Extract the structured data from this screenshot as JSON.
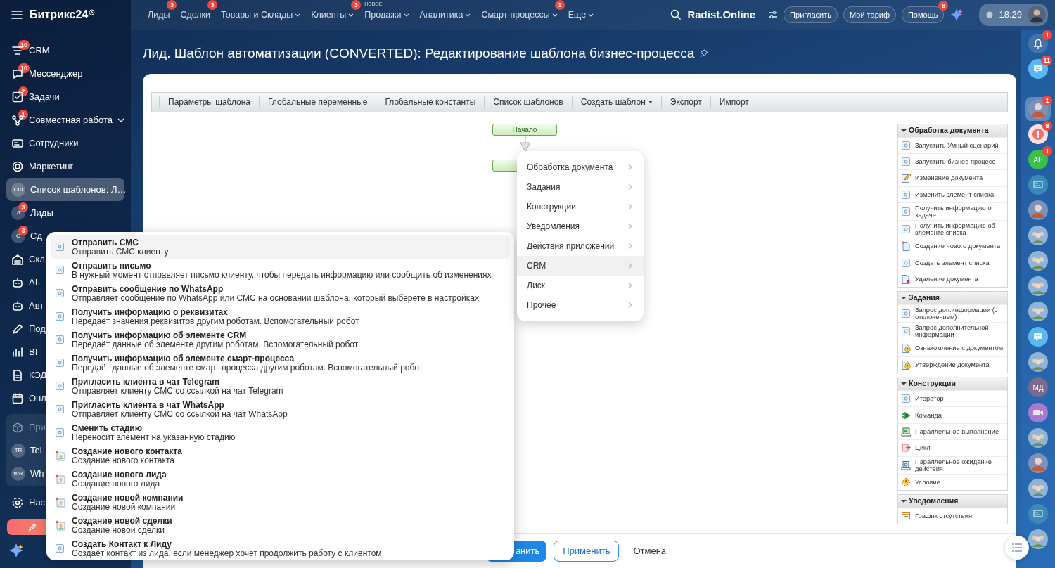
{
  "app": {
    "logo": "Битрикс24"
  },
  "top_nav": [
    {
      "label": "Лиды",
      "badge": "3"
    },
    {
      "label": "Сделки",
      "badge": "3"
    },
    {
      "label": "Товары и Склады",
      "caret": true
    },
    {
      "label": "Клиенты",
      "badge": "3",
      "caret": true
    },
    {
      "label": "Продажи",
      "tag": "НОВОЕ",
      "caret": true
    },
    {
      "label": "Аналитика",
      "caret": true
    },
    {
      "label": "Смарт-процессы",
      "badge": "1",
      "caret": true
    },
    {
      "label": "Еще",
      "caret": true
    }
  ],
  "top_right": {
    "portal": "Radist.Online",
    "buttons": [
      {
        "label": "Пригласить"
      },
      {
        "label": "Мой тариф"
      },
      {
        "label": "Помощь",
        "badge": "8"
      }
    ],
    "time": "18:29"
  },
  "sidebar": {
    "items": [
      {
        "kind": "funnel",
        "label": "CRM",
        "badge": "10",
        "selected": false
      },
      {
        "kind": "chat",
        "label": "Мессенджер",
        "badge": "10",
        "selected": false
      },
      {
        "kind": "task",
        "label": "Задачи",
        "badge": "2",
        "selected": false
      },
      {
        "kind": "collab",
        "label": "Совместная работа",
        "badge": "1",
        "caret": true,
        "selected": false
      },
      {
        "kind": "idcard",
        "label": "Сотрудники",
        "selected": false
      },
      {
        "kind": "target",
        "label": "Маркетинг",
        "selected": false
      },
      {
        "kind": "avatar",
        "initials": "СШ",
        "label": "Список шаблонов: Л…",
        "selected": true
      },
      {
        "kind": "avatar",
        "initials": "Л",
        "label": "Лиды",
        "badge": "3",
        "selected": false
      },
      {
        "kind": "avatar",
        "initials": "С",
        "label": "Сд",
        "badge": "3",
        "selected": false
      },
      {
        "kind": "warehouse",
        "label": "Скл",
        "selected": false
      },
      {
        "kind": "robot",
        "label": "AI-",
        "selected": false
      },
      {
        "kind": "robot",
        "label": "Авт",
        "selected": false
      },
      {
        "kind": "pen",
        "label": "Под",
        "selected": false
      },
      {
        "kind": "chart",
        "label": "BI",
        "selected": false
      },
      {
        "kind": "doc",
        "label": "КЭД",
        "selected": false
      },
      {
        "kind": "calendar",
        "label": "Онл",
        "selected": false
      }
    ],
    "apps": {
      "title": "При",
      "items": [
        {
          "initials": "TR",
          "label": "Tel"
        },
        {
          "initials": "WR",
          "label": "Wh"
        }
      ]
    },
    "settings": "Нас"
  },
  "page": {
    "title": "Лид. Шаблон автоматизации (CONVERTED): Редактирование шаблона бизнес-процесса"
  },
  "toolbar": [
    {
      "label": "Параметры шаблона"
    },
    {
      "label": "Глобальные переменные"
    },
    {
      "label": "Глобальные константы"
    },
    {
      "label": "Список шаблонов"
    },
    {
      "label": "Создать шаблон",
      "caret": true
    },
    {
      "label": "Экспорт"
    },
    {
      "label": "Импорт"
    }
  ],
  "canvas": {
    "start_node": "Начало"
  },
  "activity_panel": [
    {
      "title": "Обработка документа",
      "expanded": true,
      "items": [
        {
          "label": "Запустить Умный сценарий",
          "kind": "generic"
        },
        {
          "label": "Запустить бизнес-процесс",
          "kind": "generic"
        },
        {
          "label": "Изменение документа",
          "kind": "edit"
        },
        {
          "label": "Изменить элемент списка",
          "kind": "generic"
        },
        {
          "label": "Получить информацию о задаче",
          "kind": "generic"
        },
        {
          "label": "Получить информацию об элементе списка",
          "kind": "generic"
        },
        {
          "label": "Создание нового документа",
          "kind": "docnew"
        },
        {
          "label": "Создать элемент списка",
          "kind": "generic"
        },
        {
          "label": "Удаление документа",
          "kind": "delete"
        }
      ]
    },
    {
      "title": "Задания",
      "expanded": true,
      "items": [
        {
          "label": "Запрос доп.информации (с отклонением)",
          "kind": "generic"
        },
        {
          "label": "Запрос дополнительной информации",
          "kind": "generic"
        },
        {
          "label": "Ознакомление с документом",
          "kind": "warn"
        },
        {
          "label": "Утверждение документа",
          "kind": "warn"
        }
      ]
    },
    {
      "title": "Конструкции",
      "expanded": true,
      "items": [
        {
          "label": "Итератор",
          "kind": "generic"
        },
        {
          "label": "Команда",
          "kind": "command"
        },
        {
          "label": "Параллельное выполнение",
          "kind": "parallel"
        },
        {
          "label": "Цикл",
          "kind": "loop"
        },
        {
          "label": "Параллельное ожидание действия",
          "kind": "wait"
        },
        {
          "label": "Условие",
          "kind": "condition"
        }
      ]
    },
    {
      "title": "Уведомления",
      "expanded": true,
      "items": [
        {
          "label": "График отсутствия",
          "kind": "schedule"
        }
      ]
    }
  ],
  "category_menu": [
    {
      "label": "Обработка документа",
      "selected": false
    },
    {
      "label": "Задания",
      "selected": false
    },
    {
      "label": "Конструкции",
      "selected": false
    },
    {
      "label": "Уведомления",
      "selected": false
    },
    {
      "label": "Действия приложений",
      "selected": false
    },
    {
      "label": "CRM",
      "selected": true
    },
    {
      "label": "Диск",
      "selected": false
    },
    {
      "label": "Прочее",
      "selected": false
    }
  ],
  "activity_popup": [
    {
      "title": "Отправить СМС",
      "description": "Отправить СМС клиенту",
      "kind": "generic",
      "selected": true
    },
    {
      "title": "Отправить письмо",
      "description": "В нужный момент отправляет письмо клиенту, чтобы передать информацию или сообщить об изменениях",
      "kind": "generic",
      "selected": false
    },
    {
      "title": "Отправить сообщение по WhatsApp",
      "description": "Отправляет сообщение по WhatsApp или СМС на основании шаблона, который выберете в настройках",
      "kind": "generic",
      "selected": false
    },
    {
      "title": "Получить информацию о реквизитах",
      "description": "Передаёт значения реквизитов другим роботам. Вспомогательный робот",
      "kind": "generic",
      "selected": false
    },
    {
      "title": "Получить информацию об элементе CRM",
      "description": "Передаёт данные об элементе другим роботам. Вспомогательный робот",
      "kind": "generic",
      "selected": false
    },
    {
      "title": "Получить информацию об элементе смарт-процесса",
      "description": "Передаёт данные об элементе смарт-процесса другим роботам. Вспомогательный робот",
      "kind": "generic",
      "selected": false
    },
    {
      "title": "Пригласить клиента в чат Telegram",
      "description": "Отправляет клиенту СМС со ссылкой на чат Telegram",
      "kind": "generic",
      "selected": false
    },
    {
      "title": "Пригласить клиента в чат WhatsApp",
      "description": "Отправляет клиенту СМС со ссылкой на чат WhatsApp",
      "kind": "generic",
      "selected": false
    },
    {
      "title": "Сменить стадию",
      "description": "Переносит элемент на указанную стадию",
      "kind": "generic",
      "selected": false
    },
    {
      "title": "Создание нового контакта",
      "description": "Создание нового контакта",
      "kind": "crmnew",
      "selected": false
    },
    {
      "title": "Создание нового лида",
      "description": "Создание нового лида",
      "kind": "crmnew",
      "selected": false
    },
    {
      "title": "Создание новой компании",
      "description": "Создание новой компании",
      "kind": "crmnew",
      "selected": false
    },
    {
      "title": "Создание новой сделки",
      "description": "Создание новой сделки",
      "kind": "crmnew",
      "selected": false
    },
    {
      "title": "Создать Контакт к Лиду",
      "description": "Создаёт контакт из лида, если менеджер хочет продолжить работу с клиентом",
      "kind": "generic",
      "selected": false
    }
  ],
  "footer": {
    "buttons": [
      {
        "label": "анить",
        "kind": "primary"
      },
      {
        "label": "Применить",
        "kind": "outline"
      },
      {
        "label": "Отмена",
        "kind": "link"
      }
    ]
  },
  "rail": {
    "top": [
      {
        "kind": "bell",
        "badge": "1"
      },
      {
        "kind": "chat",
        "badge": "11"
      }
    ],
    "items": [
      {
        "kind": "photo",
        "badge": "1",
        "selected": true
      },
      {
        "kind": "alert",
        "badge": "8",
        "selected": false
      },
      {
        "kind": "initials",
        "text": "АР",
        "color": "#3bbf4a",
        "badge": "1",
        "selected": false
      },
      {
        "kind": "card",
        "selected": false
      },
      {
        "kind": "photo",
        "selected": false
      },
      {
        "kind": "group",
        "selected": false
      },
      {
        "kind": "group",
        "selected": false
      },
      {
        "kind": "group",
        "selected": false
      },
      {
        "kind": "group",
        "selected": false
      },
      {
        "kind": "chat",
        "selected": false
      },
      {
        "kind": "group",
        "selected": false
      },
      {
        "kind": "initials",
        "text": "МД",
        "color": "#7a6a8c",
        "selected": false
      },
      {
        "kind": "video",
        "selected": false
      },
      {
        "kind": "group",
        "selected": false
      },
      {
        "kind": "photo",
        "selected": false
      },
      {
        "kind": "group",
        "selected": false
      },
      {
        "kind": "card",
        "selected": false
      },
      {
        "kind": "group",
        "selected": false
      }
    ]
  }
}
